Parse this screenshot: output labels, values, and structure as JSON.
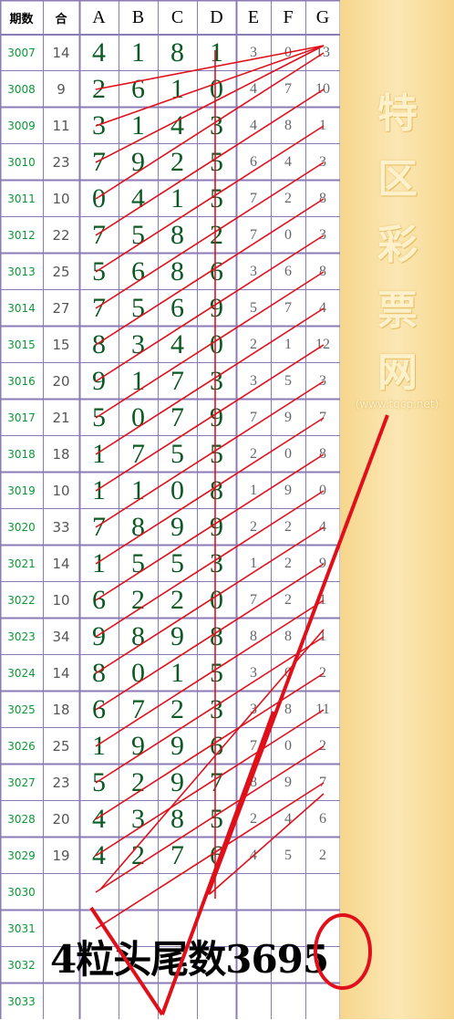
{
  "header": {
    "period": "期数",
    "sum": "合",
    "columns": [
      "A",
      "B",
      "C",
      "D",
      "E",
      "F",
      "G"
    ]
  },
  "rows": [
    {
      "period": "3007",
      "sum": "14",
      "values": [
        "4",
        "1",
        "8",
        "1",
        "3",
        "0",
        "13"
      ]
    },
    {
      "period": "3008",
      "sum": "9",
      "values": [
        "2",
        "6",
        "1",
        "0",
        "4",
        "7",
        "10"
      ]
    },
    {
      "period": "3009",
      "sum": "11",
      "values": [
        "3",
        "1",
        "4",
        "3",
        "4",
        "8",
        "1"
      ]
    },
    {
      "period": "3010",
      "sum": "23",
      "values": [
        "7",
        "9",
        "2",
        "5",
        "6",
        "4",
        "3"
      ]
    },
    {
      "period": "3011",
      "sum": "10",
      "values": [
        "0",
        "4",
        "1",
        "5",
        "7",
        "2",
        "8"
      ]
    },
    {
      "period": "3012",
      "sum": "22",
      "values": [
        "7",
        "5",
        "8",
        "2",
        "7",
        "0",
        "3"
      ]
    },
    {
      "period": "3013",
      "sum": "25",
      "values": [
        "5",
        "6",
        "8",
        "6",
        "3",
        "6",
        "8"
      ]
    },
    {
      "period": "3014",
      "sum": "27",
      "values": [
        "7",
        "5",
        "6",
        "9",
        "5",
        "7",
        "4"
      ]
    },
    {
      "period": "3015",
      "sum": "15",
      "values": [
        "8",
        "3",
        "4",
        "0",
        "2",
        "1",
        "12"
      ]
    },
    {
      "period": "3016",
      "sum": "20",
      "values": [
        "9",
        "1",
        "7",
        "3",
        "3",
        "5",
        "3"
      ]
    },
    {
      "period": "3017",
      "sum": "21",
      "values": [
        "5",
        "0",
        "7",
        "9",
        "7",
        "9",
        "7"
      ]
    },
    {
      "period": "3018",
      "sum": "18",
      "values": [
        "1",
        "7",
        "5",
        "5",
        "2",
        "0",
        "8"
      ]
    },
    {
      "period": "3019",
      "sum": "10",
      "values": [
        "1",
        "1",
        "0",
        "8",
        "1",
        "9",
        "0"
      ]
    },
    {
      "period": "3020",
      "sum": "33",
      "values": [
        "7",
        "8",
        "9",
        "9",
        "2",
        "2",
        "4"
      ]
    },
    {
      "period": "3021",
      "sum": "14",
      "values": [
        "1",
        "5",
        "5",
        "3",
        "1",
        "2",
        "9"
      ]
    },
    {
      "period": "3022",
      "sum": "10",
      "values": [
        "6",
        "2",
        "2",
        "0",
        "7",
        "2",
        "1"
      ]
    },
    {
      "period": "3023",
      "sum": "34",
      "values": [
        "9",
        "8",
        "9",
        "8",
        "8",
        "8",
        "1"
      ]
    },
    {
      "period": "3024",
      "sum": "14",
      "values": [
        "8",
        "0",
        "1",
        "5",
        "3",
        "0",
        "2"
      ]
    },
    {
      "period": "3025",
      "sum": "18",
      "values": [
        "6",
        "7",
        "2",
        "3",
        "3",
        "8",
        "11"
      ]
    },
    {
      "period": "3026",
      "sum": "25",
      "values": [
        "1",
        "9",
        "9",
        "6",
        "7",
        "0",
        "2"
      ]
    },
    {
      "period": "3027",
      "sum": "23",
      "values": [
        "5",
        "2",
        "9",
        "7",
        "8",
        "9",
        "7"
      ]
    },
    {
      "period": "3028",
      "sum": "20",
      "values": [
        "4",
        "3",
        "8",
        "5",
        "2",
        "4",
        "6"
      ]
    },
    {
      "period": "3029",
      "sum": "19",
      "values": [
        "4",
        "2",
        "7",
        "6",
        "4",
        "5",
        "2"
      ]
    },
    {
      "period": "3030",
      "sum": "",
      "values": [
        "",
        "",
        "",
        "",
        "",
        "",
        ""
      ]
    },
    {
      "period": "3031",
      "sum": "",
      "values": [
        "",
        "",
        "",
        "",
        "",
        "",
        ""
      ]
    },
    {
      "period": "3032",
      "sum": "",
      "values": [
        "",
        "",
        "",
        "",
        "",
        "",
        ""
      ]
    },
    {
      "period": "3033",
      "sum": "",
      "values": [
        "",
        "",
        "",
        "",
        "",
        "",
        ""
      ]
    }
  ],
  "sidebar": {
    "watermark_chars": [
      "特",
      "区",
      "彩",
      "票",
      "网"
    ],
    "site": "(www.tqcp.net)"
  },
  "caption": "4粒头尾数3695",
  "colors": {
    "grid_line": "#8b7bb5",
    "period_text": "#0a9a35",
    "abcd_text": "#0b5a23",
    "efg_text": "#666666",
    "annotation": "#e0101a",
    "sidebar": "#f6d68c"
  }
}
